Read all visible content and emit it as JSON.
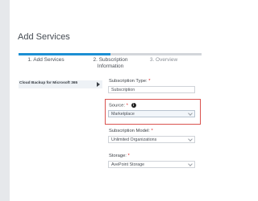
{
  "dialog": {
    "title": "Add Services"
  },
  "progress": {
    "completed_fraction": 0.5
  },
  "steps": [
    {
      "label": "1. Add Services"
    },
    {
      "label": "2. Subscription\nInformation"
    },
    {
      "label": "3. Overview"
    }
  ],
  "services": {
    "items": [
      {
        "label": "Cloud Backup for Microsoft 365"
      }
    ]
  },
  "form": {
    "subscription_type": {
      "label": "Subscription Type:",
      "required_mark": "*",
      "value": "Subscription"
    },
    "source": {
      "label": "Source:",
      "required_mark": "*",
      "value": "Marketplace",
      "info_icon": "info-icon"
    },
    "subscription_model": {
      "label": "Subscription Model:",
      "required_mark": "*",
      "value": "Unlimited Organizations"
    },
    "storage": {
      "label": "Storage:",
      "required_mark": "*",
      "value": "AvePoint Storage"
    }
  },
  "colors": {
    "accent": "#1c8fd3",
    "highlight_border": "#d9534f"
  }
}
